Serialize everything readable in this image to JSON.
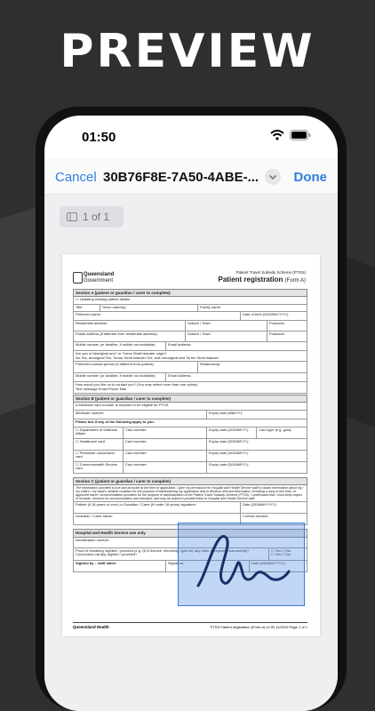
{
  "headline": "PREVIEW",
  "status": {
    "time": "01:50"
  },
  "nav": {
    "cancel_label": "Cancel",
    "document_title": "30B76F8E-7A50-4ABE-...",
    "done_label": "Done"
  },
  "viewer": {
    "page_indicator": "1 of 1"
  },
  "form": {
    "org_line1": "Queensland",
    "org_line2": "Government",
    "scheme": "Patient Travel Subsidy Scheme (PTSS)",
    "title": "Patient registration",
    "title_suffix": "(Form A)",
    "section_a": "Section A (patient or guardian / carer to complete)",
    "updating": "Updating existing patient details",
    "title_field": "Title:",
    "given_names": "Given name(s):",
    "family_name": "Family name:",
    "preferred_name": "Preferred name:",
    "dob": "Date of birth (DD/MM/YYYY):",
    "residential": "Residential address:",
    "suburb": "Suburb / Town:",
    "postcode": "Postcode:",
    "postal": "Postal address (if different from residential address):",
    "mobile": "Mobile number (or landline, if mobile not available):",
    "email": "Email address:",
    "aboriginal_q": "Are you of Aboriginal and / or Torres Strait Islander origin?",
    "aboriginal_opts": "No   Yes, Aboriginal   Yes, Torres Strait Islander   Yes, both Aboriginal and Torres Strait Islander",
    "contact_person": "Preferred contact person (if different from patient):",
    "relationship": "Relationship:",
    "contact_q": "How would you like us to contact you? (You may select more than one option)",
    "contact_opts": "Text message   Email   Phone   Mail",
    "section_b": "Section B (patient or guardian / carer to complete)",
    "medicare_note": "A Medicare card number is required to be eligible for PTSS.",
    "medicare_number": "Medicare number:",
    "expiry_mmyy": "Expiry date (MM/YY):",
    "tick_note": "Please tick if any of the following apply to you:",
    "dva": "Department of Veterans Affairs",
    "card_number": "Card number:",
    "expiry_full": "Expiry date (DD/MM/YY):",
    "card_type": "Card type (e.g. gold):",
    "healthcare": "Healthcare card",
    "pensioner": "Pensioner concession card",
    "seniors": "Commonwealth Seniors card",
    "section_c": "Section C (patient or guardian / carer to complete)",
    "declaration": "The information provided is true and accurate at the time of application. I give my permission for Hospital and Health Service staff to obtain information about my / my child's / my ward's medical condition for the purpose of administering my application and to disclose relevant information, including a copy of this form, to approved travel / accommodation providers for the purpose of administration of the Patient Travel Subsidy Scheme (PTSS). I understand that I must keep copies of receipts / invoices for accommodation and transport, and may be asked to provide these to Hospital and Health Service staff.",
    "patient_sig": "Patient (if 18 years or over) or Guardian / Carer (if under 18 years) signature:",
    "date": "Date (DD/MM/YYYY):",
    "guardian_name": "Guardian / Carer name:",
    "contact_number": "Contact number:",
    "hhs_section": "Hospital and Health Service use only",
    "identification": "Identification number:",
    "proof": "Proof of residency sighted / provided (e.g. QLD licence, electricity / gas bill, any other acceptable documents)?",
    "concession": "Concession card(s) sighted / provided?",
    "yes": "Yes",
    "no": "No",
    "sighted_by": "Sighted by – staff name:",
    "signature": "Signature:",
    "footer_org": "Queensland Health",
    "footer_meta": "PTSS   Patient registration (Form A)   v2.00   11/2019   Page 1 of 1"
  },
  "colors": {
    "accent": "#2f7fe0",
    "signature_overlay": "#508ce6",
    "signature_stroke": "#1a2f66"
  }
}
